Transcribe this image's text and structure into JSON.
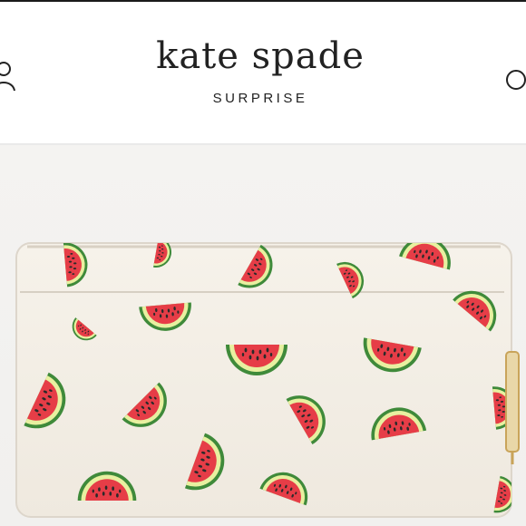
{
  "header": {
    "brand_title": "kate spade",
    "brand_subtitle": "SURPRISE",
    "left_icon": "user-icon",
    "right_icon": "search-icon"
  },
  "product": {
    "image_subject": "watermark-wallet",
    "colors": {
      "wallet_body": "#f4f0e8",
      "watermelon_flesh": "#e63d47",
      "watermelon_rind_light": "#e8f0a0",
      "watermelon_rind_dark": "#3f8a3a",
      "seeds": "#2a2a2a",
      "zipper_pull": "#c9a45a"
    }
  }
}
